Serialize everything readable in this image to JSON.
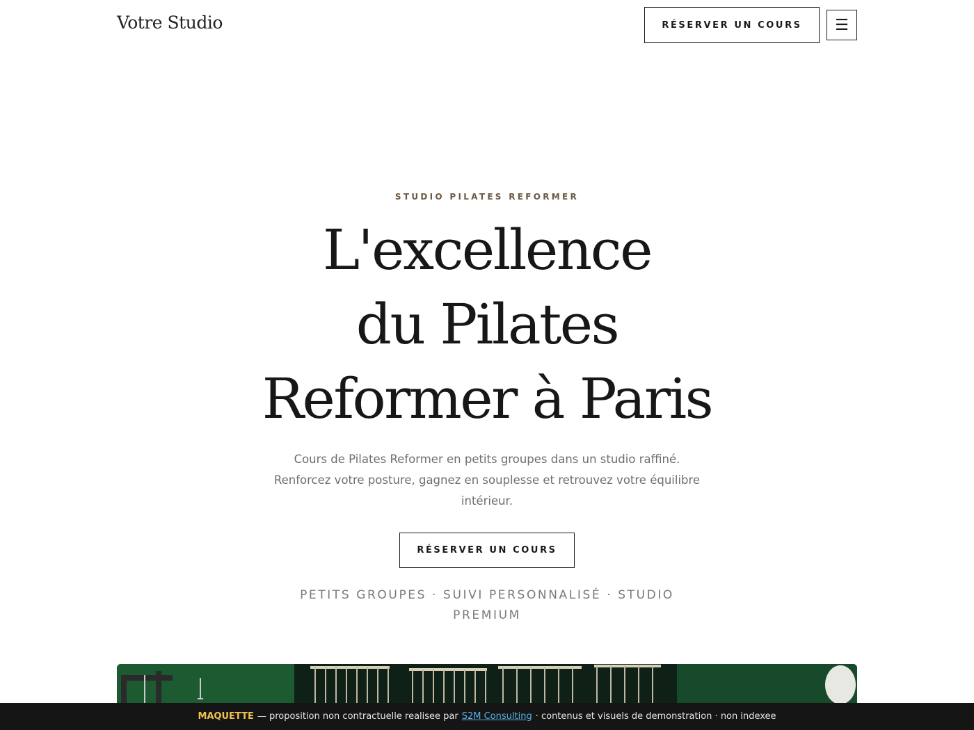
{
  "header": {
    "logo": "Votre Studio",
    "cta_label": "RÉSERVER UN COURS",
    "menu_glyph": "☰"
  },
  "hero": {
    "eyebrow": "STUDIO PILATES REFORMER",
    "title_lines": [
      "L'excellence",
      "du Pilates",
      "Reformer à Paris"
    ],
    "lead": "Cours de Pilates Reformer en petits groupes dans un studio raffiné. Renforcez votre posture, gagnez en souplesse et retrouvez votre équilibre intérieur.",
    "cta_label": "RÉSERVER UN COURS",
    "features": "PETITS GROUPES · SUIVI PERSONNALISÉ · STUDIO PREMIUM"
  },
  "banner": {
    "tag": "MAQUETTE",
    "text_before": "— proposition non contractuelle realisee par",
    "link_label": "S2M Consulting",
    "text_after": "· contenus et visuels de demonstration · non indexee"
  },
  "colors": {
    "accent": "#6b5a44",
    "text": "#171717",
    "muted": "#6e6e6e",
    "banner_bg": "#151515",
    "banner_tag": "#f2c14e",
    "banner_link": "#5ab0e8",
    "photo_green": "#123d24"
  }
}
